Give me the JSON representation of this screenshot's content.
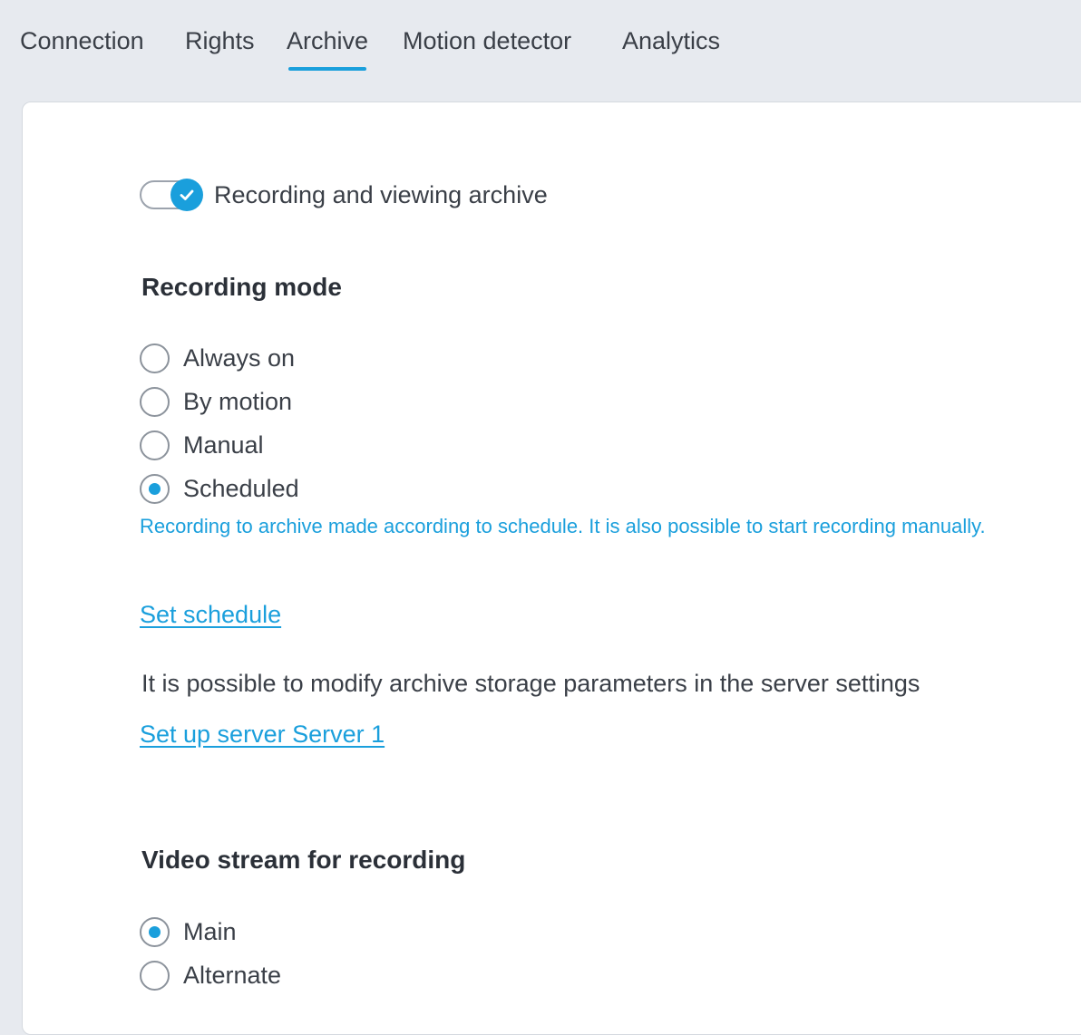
{
  "tabs": [
    {
      "label": "Connection",
      "active": false
    },
    {
      "label": "Rights",
      "active": false
    },
    {
      "label": "Archive",
      "active": true
    },
    {
      "label": "Motion detector",
      "active": false
    },
    {
      "label": "Analytics",
      "active": false
    }
  ],
  "archive_toggle": {
    "label": "Recording and viewing archive",
    "enabled": true
  },
  "recording_mode": {
    "title": "Recording mode",
    "options": [
      {
        "label": "Always on",
        "selected": false
      },
      {
        "label": "By motion",
        "selected": false
      },
      {
        "label": "Manual",
        "selected": false
      },
      {
        "label": "Scheduled",
        "selected": true
      }
    ],
    "hint": "Recording to archive made according to schedule. It is also possible to start recording manually.",
    "schedule_link": "Set schedule"
  },
  "server_info": {
    "text": "It is possible to modify archive storage parameters in the server settings",
    "link": "Set up server Server 1"
  },
  "video_stream": {
    "title": "Video stream for recording",
    "options": [
      {
        "label": "Main",
        "selected": true
      },
      {
        "label": "Alternate",
        "selected": false
      }
    ]
  },
  "colors": {
    "accent": "#1a9fdc",
    "background": "#e7eaef",
    "panel": "#ffffff",
    "text": "#3a3f47"
  }
}
